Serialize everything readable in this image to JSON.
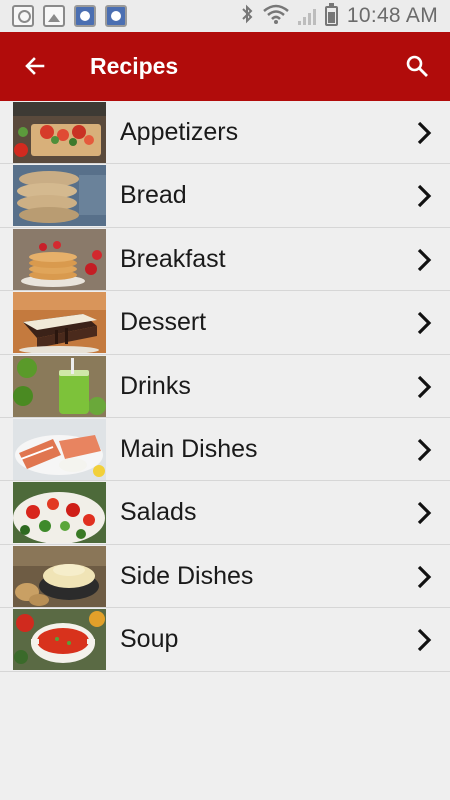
{
  "status_bar": {
    "time": "10:48 AM"
  },
  "app_bar": {
    "title": "Recipes"
  },
  "colors": {
    "app_bar": "#b10c0b",
    "background": "#efefef",
    "divider": "#d6d6d6"
  },
  "icons": {
    "back": "arrow-left-icon",
    "search": "search-icon",
    "chevron": "chevron-right-icon"
  },
  "categories": [
    {
      "label": "Appetizers"
    },
    {
      "label": "Bread"
    },
    {
      "label": "Breakfast"
    },
    {
      "label": "Dessert"
    },
    {
      "label": "Drinks"
    },
    {
      "label": "Main Dishes"
    },
    {
      "label": "Salads"
    },
    {
      "label": "Side Dishes"
    },
    {
      "label": "Soup"
    }
  ]
}
